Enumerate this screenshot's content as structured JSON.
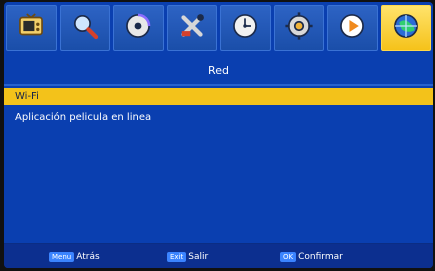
{
  "menu": {
    "tabs": [
      {
        "icon": "tv-icon"
      },
      {
        "icon": "magnifier-icon"
      },
      {
        "icon": "disc-icon"
      },
      {
        "icon": "tools-icon"
      },
      {
        "icon": "clock-icon"
      },
      {
        "icon": "gear-icon"
      },
      {
        "icon": "play-icon"
      },
      {
        "icon": "globe-icon"
      }
    ],
    "active_tab_index": 7
  },
  "page": {
    "title": "Red",
    "items": [
      {
        "label": "Wi-Fi",
        "selected": true
      },
      {
        "label": "Aplicación pelicula en linea",
        "selected": false
      }
    ]
  },
  "footer": {
    "items": [
      {
        "key": "Menu",
        "label": "Atrás"
      },
      {
        "key": "Exit",
        "label": "Salir"
      },
      {
        "key": "OK",
        "label": "Confirmar"
      }
    ]
  },
  "colors": {
    "background": "#0a3fb0",
    "highlight": "#f3c21a",
    "key_badge": "#3b84ff"
  }
}
